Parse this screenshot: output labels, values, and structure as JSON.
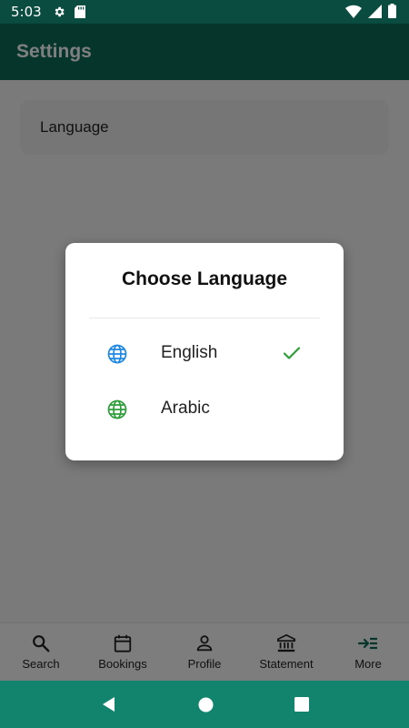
{
  "status_bar": {
    "time": "5:03"
  },
  "app_bar": {
    "title": "Settings"
  },
  "settings": {
    "language_label": "Language"
  },
  "dialog": {
    "title": "Choose Language",
    "options": [
      {
        "label": "English",
        "selected": true,
        "icon": "globe-icon",
        "icon_color": "#1e88e5"
      },
      {
        "label": "Arabic",
        "selected": false,
        "icon": "globe-icon",
        "icon_color": "#2e9e3a"
      }
    ],
    "check_color": "#2e9e3a"
  },
  "bottom_nav": {
    "items": [
      {
        "label": "Search",
        "icon": "search-icon"
      },
      {
        "label": "Bookings",
        "icon": "calendar-icon"
      },
      {
        "label": "Profile",
        "icon": "person-icon"
      },
      {
        "label": "Statement",
        "icon": "bank-icon"
      },
      {
        "label": "More",
        "icon": "more-menu-icon",
        "active": true
      }
    ]
  },
  "colors": {
    "primary": "#0c6b58",
    "primary_dark": "#0a4d40",
    "accent": "#12846d"
  }
}
